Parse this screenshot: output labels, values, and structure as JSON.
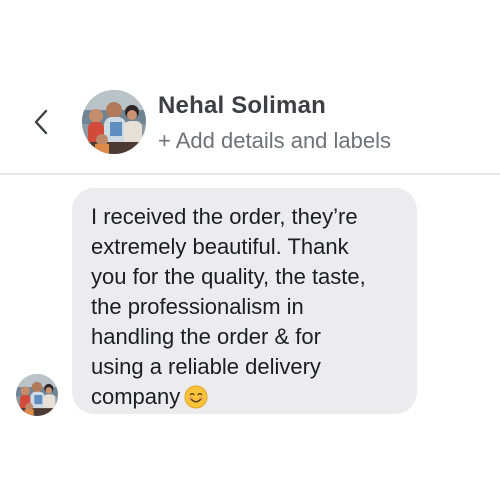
{
  "header": {
    "back_icon": "chevron-left-icon",
    "contact_name": "Nehal Soliman",
    "add_details_label": "+ Add details and labels"
  },
  "conversation": {
    "message": {
      "text": "I received the order, they’re\nextremely beautiful. Thank\nyou for the quality, the taste,\nthe professionalism in\nhandling the order & for\nusing a reliable delivery\ncompany",
      "emoji": "smiling-face-icon"
    }
  },
  "colors": {
    "bubble": "#ececee",
    "name_text": "#3c3f44",
    "secondary_text": "#6d7278",
    "divider": "#e6e7ea"
  }
}
